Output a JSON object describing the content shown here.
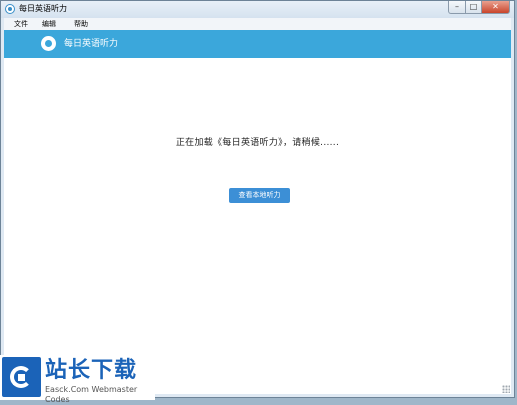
{
  "window": {
    "title": "每日英语听力",
    "controls": {
      "minimize": "–",
      "maximize": "□",
      "close": "✕"
    }
  },
  "menubar": {
    "items": [
      {
        "label": "文件"
      },
      {
        "label": "编辑"
      },
      {
        "label": "帮助"
      }
    ]
  },
  "header": {
    "title": "每日英语听力",
    "icon": "app-logo-icon"
  },
  "main": {
    "loading_text": "正在加载《每日英语听力》，请稍候......",
    "view_local_button": "查看本地听力"
  },
  "watermark": {
    "big_text": "站长下载",
    "small_text": "Easck.Com Webmaster Codes"
  },
  "colors": {
    "header_band": "#3ba7db",
    "button": "#3c8fd6",
    "watermark": "#1b63b8"
  }
}
